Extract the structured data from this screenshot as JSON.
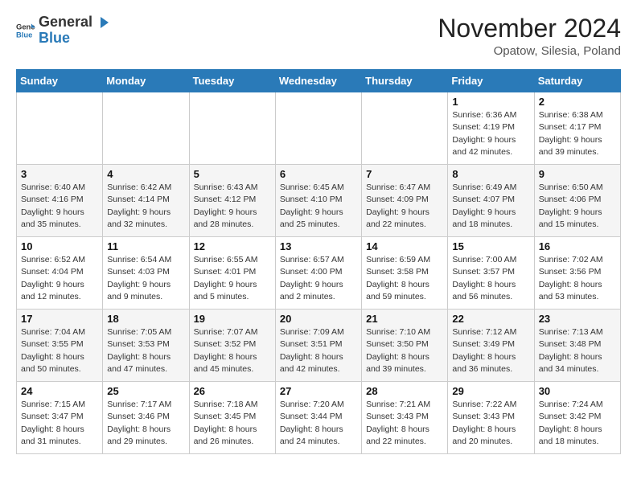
{
  "logo": {
    "general": "General",
    "blue": "Blue"
  },
  "header": {
    "month": "November 2024",
    "location": "Opatow, Silesia, Poland"
  },
  "weekdays": [
    "Sunday",
    "Monday",
    "Tuesday",
    "Wednesday",
    "Thursday",
    "Friday",
    "Saturday"
  ],
  "weeks": [
    [
      {
        "day": "",
        "info": ""
      },
      {
        "day": "",
        "info": ""
      },
      {
        "day": "",
        "info": ""
      },
      {
        "day": "",
        "info": ""
      },
      {
        "day": "",
        "info": ""
      },
      {
        "day": "1",
        "info": "Sunrise: 6:36 AM\nSunset: 4:19 PM\nDaylight: 9 hours\nand 42 minutes."
      },
      {
        "day": "2",
        "info": "Sunrise: 6:38 AM\nSunset: 4:17 PM\nDaylight: 9 hours\nand 39 minutes."
      }
    ],
    [
      {
        "day": "3",
        "info": "Sunrise: 6:40 AM\nSunset: 4:16 PM\nDaylight: 9 hours\nand 35 minutes."
      },
      {
        "day": "4",
        "info": "Sunrise: 6:42 AM\nSunset: 4:14 PM\nDaylight: 9 hours\nand 32 minutes."
      },
      {
        "day": "5",
        "info": "Sunrise: 6:43 AM\nSunset: 4:12 PM\nDaylight: 9 hours\nand 28 minutes."
      },
      {
        "day": "6",
        "info": "Sunrise: 6:45 AM\nSunset: 4:10 PM\nDaylight: 9 hours\nand 25 minutes."
      },
      {
        "day": "7",
        "info": "Sunrise: 6:47 AM\nSunset: 4:09 PM\nDaylight: 9 hours\nand 22 minutes."
      },
      {
        "day": "8",
        "info": "Sunrise: 6:49 AM\nSunset: 4:07 PM\nDaylight: 9 hours\nand 18 minutes."
      },
      {
        "day": "9",
        "info": "Sunrise: 6:50 AM\nSunset: 4:06 PM\nDaylight: 9 hours\nand 15 minutes."
      }
    ],
    [
      {
        "day": "10",
        "info": "Sunrise: 6:52 AM\nSunset: 4:04 PM\nDaylight: 9 hours\nand 12 minutes."
      },
      {
        "day": "11",
        "info": "Sunrise: 6:54 AM\nSunset: 4:03 PM\nDaylight: 9 hours\nand 9 minutes."
      },
      {
        "day": "12",
        "info": "Sunrise: 6:55 AM\nSunset: 4:01 PM\nDaylight: 9 hours\nand 5 minutes."
      },
      {
        "day": "13",
        "info": "Sunrise: 6:57 AM\nSunset: 4:00 PM\nDaylight: 9 hours\nand 2 minutes."
      },
      {
        "day": "14",
        "info": "Sunrise: 6:59 AM\nSunset: 3:58 PM\nDaylight: 8 hours\nand 59 minutes."
      },
      {
        "day": "15",
        "info": "Sunrise: 7:00 AM\nSunset: 3:57 PM\nDaylight: 8 hours\nand 56 minutes."
      },
      {
        "day": "16",
        "info": "Sunrise: 7:02 AM\nSunset: 3:56 PM\nDaylight: 8 hours\nand 53 minutes."
      }
    ],
    [
      {
        "day": "17",
        "info": "Sunrise: 7:04 AM\nSunset: 3:55 PM\nDaylight: 8 hours\nand 50 minutes."
      },
      {
        "day": "18",
        "info": "Sunrise: 7:05 AM\nSunset: 3:53 PM\nDaylight: 8 hours\nand 47 minutes."
      },
      {
        "day": "19",
        "info": "Sunrise: 7:07 AM\nSunset: 3:52 PM\nDaylight: 8 hours\nand 45 minutes."
      },
      {
        "day": "20",
        "info": "Sunrise: 7:09 AM\nSunset: 3:51 PM\nDaylight: 8 hours\nand 42 minutes."
      },
      {
        "day": "21",
        "info": "Sunrise: 7:10 AM\nSunset: 3:50 PM\nDaylight: 8 hours\nand 39 minutes."
      },
      {
        "day": "22",
        "info": "Sunrise: 7:12 AM\nSunset: 3:49 PM\nDaylight: 8 hours\nand 36 minutes."
      },
      {
        "day": "23",
        "info": "Sunrise: 7:13 AM\nSunset: 3:48 PM\nDaylight: 8 hours\nand 34 minutes."
      }
    ],
    [
      {
        "day": "24",
        "info": "Sunrise: 7:15 AM\nSunset: 3:47 PM\nDaylight: 8 hours\nand 31 minutes."
      },
      {
        "day": "25",
        "info": "Sunrise: 7:17 AM\nSunset: 3:46 PM\nDaylight: 8 hours\nand 29 minutes."
      },
      {
        "day": "26",
        "info": "Sunrise: 7:18 AM\nSunset: 3:45 PM\nDaylight: 8 hours\nand 26 minutes."
      },
      {
        "day": "27",
        "info": "Sunrise: 7:20 AM\nSunset: 3:44 PM\nDaylight: 8 hours\nand 24 minutes."
      },
      {
        "day": "28",
        "info": "Sunrise: 7:21 AM\nSunset: 3:43 PM\nDaylight: 8 hours\nand 22 minutes."
      },
      {
        "day": "29",
        "info": "Sunrise: 7:22 AM\nSunset: 3:43 PM\nDaylight: 8 hours\nand 20 minutes."
      },
      {
        "day": "30",
        "info": "Sunrise: 7:24 AM\nSunset: 3:42 PM\nDaylight: 8 hours\nand 18 minutes."
      }
    ]
  ]
}
